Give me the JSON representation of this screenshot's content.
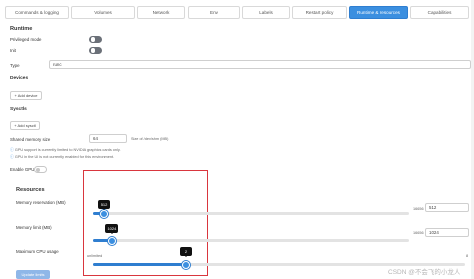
{
  "tabs": [
    {
      "label": "Commands & logging"
    },
    {
      "label": "Volumes"
    },
    {
      "label": "Network"
    },
    {
      "label": "Env"
    },
    {
      "label": "Labels"
    },
    {
      "label": "Restart policy"
    },
    {
      "label": "Runtime & resources",
      "active": true
    },
    {
      "label": "Capabilities"
    }
  ],
  "runtime": {
    "title": "Runtime",
    "privileged_label": "Privileged mode",
    "init_label": "Init",
    "type_label": "Type",
    "type_value": "runc"
  },
  "devices": {
    "title": "Devices",
    "add_label": "+ Add device"
  },
  "sysctls": {
    "title": "Sysctls",
    "add_label": "+ Add sysctl"
  },
  "shm": {
    "label": "Shared memory size",
    "value": "64",
    "unit_note": "Size of /dev/shm (MB)"
  },
  "gpu": {
    "note1": "GPU support is currently limited to NVIDIA graphics cards only.",
    "note2": "GPU in the UI is not currently enabled for this environment.",
    "enable_label": "Enable GPU"
  },
  "resources": {
    "title": "Resources",
    "memory_reservation": {
      "label": "Memory reservation (MB)",
      "value": "512",
      "max": "16656",
      "fraction": 0.035
    },
    "memory_limit": {
      "label": "Memory limit (MB)",
      "value": "1024",
      "max": "16656",
      "fraction": 0.06
    },
    "cpu": {
      "label": "Maximum CPU usage",
      "left_text": "unlimited",
      "value": "2",
      "max": "8",
      "fraction": 0.25
    }
  },
  "update_button": "Update limits",
  "watermark": "CSDN @不会飞的小龙人",
  "colors": {
    "accent": "#3b8fe0",
    "highlight_box": "#d9363e"
  }
}
